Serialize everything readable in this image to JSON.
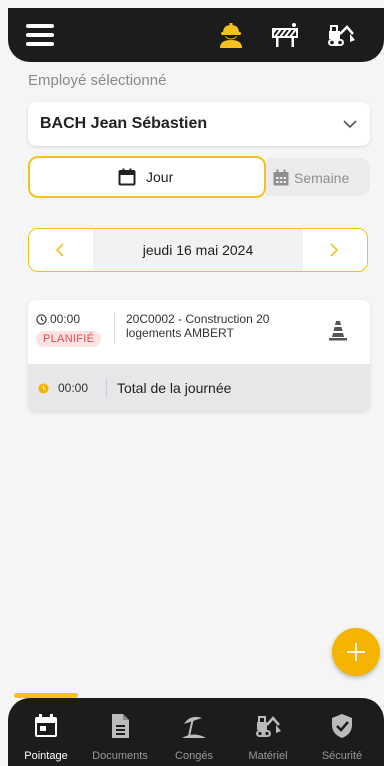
{
  "header": {
    "icons": [
      "menu-icon",
      "worker-icon",
      "roadwork-barrier-icon",
      "excavator-icon"
    ],
    "active_color": "#f4c21a"
  },
  "employee": {
    "label": "Employé sélectionné",
    "selected": "BACH Jean Sébastien"
  },
  "view_tabs": {
    "day": "Jour",
    "week": "Semaine",
    "selected": "Jour"
  },
  "date_nav": {
    "date": "jeudi 16 mai 2024"
  },
  "entry": {
    "time": "00:00",
    "status": "PLANIFIÉ",
    "project": "20C0002 - Construction 20 logements AMBERT",
    "icon": "traffic-cone-icon"
  },
  "total": {
    "time": "00:00",
    "label": "Total de la journée"
  },
  "bottom_nav": {
    "items": [
      {
        "label": "Pointage",
        "icon": "calendar-icon"
      },
      {
        "label": "Documents",
        "icon": "document-icon"
      },
      {
        "label": "Congés",
        "icon": "beach-umbrella-icon"
      },
      {
        "label": "Matériel",
        "icon": "excavator-icon"
      },
      {
        "label": "Sécurité",
        "icon": "shield-check-icon"
      }
    ],
    "active": "Pointage"
  },
  "colors": {
    "accent": "#f4c21a",
    "dark": "#1c1c1c",
    "status_planned": "#e14b52"
  }
}
